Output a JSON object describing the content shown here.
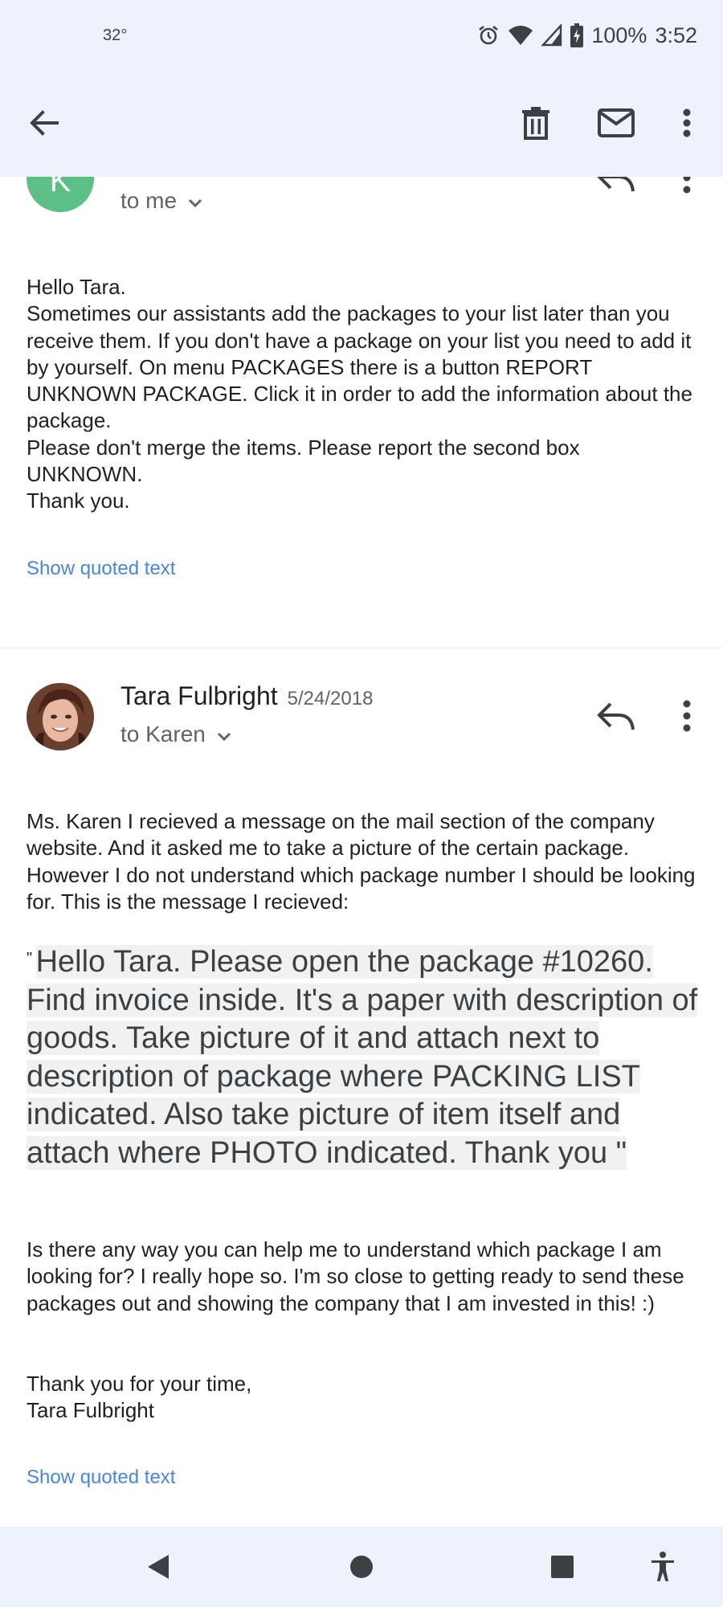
{
  "status_bar": {
    "temperature": "32°",
    "battery": "100%",
    "time": "3:52"
  },
  "toolbar": {
    "back_icon": "arrow-back-icon",
    "delete_icon": "delete-icon",
    "mail_icon": "mark-unread-icon",
    "more_icon": "more-vert-icon"
  },
  "messages": [
    {
      "avatar_letter": "K",
      "avatar_color": "#5cbf86",
      "recipient": "to me",
      "body": [
        "Hello Tara.",
        "Sometimes our assistants add the packages to your list later than you receive them. If you don't have a package on your list you need to add it by yourself. On menu PACKAGES there is a button REPORT UNKNOWN PACKAGE. Click it in order to add the information about the package.",
        "Please don't merge the items. Please report the second box UNKNOWN.",
        "Thank you."
      ],
      "show_quoted": "Show quoted text"
    },
    {
      "sender": "Tara Fulbright",
      "date": "5/24/2018",
      "recipient": "to Karen",
      "intro": "Ms. Karen I recieved a message on the mail section of the company website. And it asked me to take a picture of the certain package. However I do not understand which package number I should be looking for. This is the message I recieved:",
      "quote_open": "\"",
      "quote": "Hello Tara. Please open the package #10260. Find invoice inside. It's a paper with description of goods. Take picture of it and attach next to description of package where PACKING LIST indicated. Also take picture of item itself and attach where PHOTO indicated. Thank you \"",
      "body": "Is there any way you can help me to understand which package I am looking for? I really hope so. I'm so close to getting ready to send these packages out and showing the company that I am invested in this! :)",
      "sign_1": "Thank you for your time,",
      "sign_2": "Tara Fulbright",
      "show_quoted": "Show quoted text"
    }
  ],
  "colors": {
    "chrome_background": "#eef2fa",
    "link": "#4a86d8",
    "quote_highlight": "#f1f1f1"
  }
}
